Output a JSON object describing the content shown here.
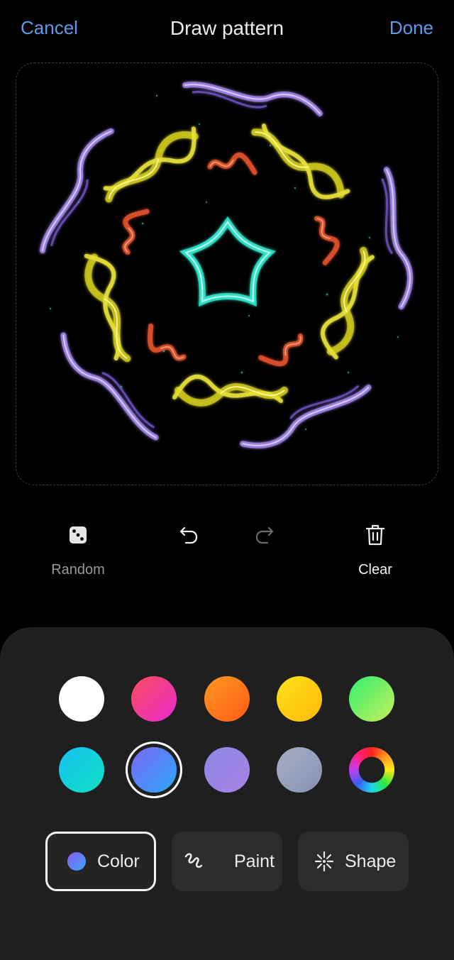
{
  "header": {
    "cancel_label": "Cancel",
    "title": "Draw pattern",
    "done_label": "Done",
    "accent_color": "#5e9bea"
  },
  "tools": {
    "random": {
      "label": "Random",
      "icon": "dice-icon"
    },
    "undo": {
      "icon": "undo-icon"
    },
    "redo": {
      "icon": "redo-icon"
    },
    "clear": {
      "label": "Clear",
      "icon": "trash-icon"
    }
  },
  "palette": {
    "swatches": [
      {
        "name": "white",
        "colors": [
          "#ffffff",
          "#ffffff"
        ]
      },
      {
        "name": "pink-red",
        "colors": [
          "#fa4d5c",
          "#ec2bd0"
        ]
      },
      {
        "name": "orange",
        "colors": [
          "#ff9924",
          "#ff5a12"
        ]
      },
      {
        "name": "yellow",
        "colors": [
          "#ffe21a",
          "#ffb808"
        ]
      },
      {
        "name": "green",
        "colors": [
          "#2df070",
          "#c9f05a"
        ]
      },
      {
        "name": "cyan",
        "colors": [
          "#17bff3",
          "#10e3c2"
        ]
      },
      {
        "name": "blue-violet",
        "colors": [
          "#7d66f7",
          "#2aa8f7"
        ],
        "selected": true
      },
      {
        "name": "lavender",
        "colors": [
          "#8c88e6",
          "#a982e3"
        ]
      },
      {
        "name": "gray-blue",
        "colors": [
          "#a7aec4",
          "#8893b3"
        ]
      },
      {
        "name": "rainbow",
        "colors": [
          "#ff0000",
          "#00ff00"
        ]
      }
    ]
  },
  "modes": {
    "color": {
      "label": "Color",
      "icon": "color-dot-icon",
      "selected": true
    },
    "paint": {
      "label": "Paint",
      "icon": "brush-stroke-icon"
    },
    "shape": {
      "label": "Shape",
      "icon": "sparkle-shape-icon"
    }
  }
}
